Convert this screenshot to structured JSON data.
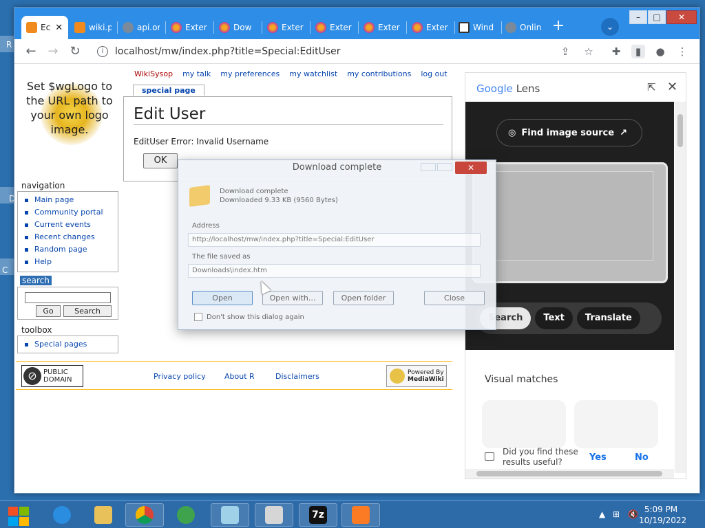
{
  "desktop": {
    "side_letters": [
      "R",
      "D",
      "C"
    ]
  },
  "browser": {
    "tabs": [
      {
        "label": "Ec",
        "icon": "mediawiki-favicon",
        "active": true
      },
      {
        "label": "wiki.p",
        "icon": "mediawiki-favicon"
      },
      {
        "label": "api.or",
        "icon": "globe-favicon"
      },
      {
        "label": "Exter",
        "icon": "firefox-favicon"
      },
      {
        "label": "Dow",
        "icon": "firefox-favicon"
      },
      {
        "label": "Exter",
        "icon": "firefox-favicon"
      },
      {
        "label": "Exter",
        "icon": "firefox-favicon"
      },
      {
        "label": "Exter",
        "icon": "firefox-favicon"
      },
      {
        "label": "Exter",
        "icon": "firefox-favicon"
      },
      {
        "label": "Wind",
        "icon": "library-favicon"
      },
      {
        "label": "Onlin",
        "icon": "globe-favicon"
      }
    ],
    "window_controls": {
      "minimize": "–",
      "maximize": "□",
      "close": "✕"
    },
    "url": "localhost/mw/index.php?title=Special:EditUser"
  },
  "wiki": {
    "logo_text": "Set $wgLogo to the URL path to your own logo image.",
    "personal": {
      "user": "WikiSysop",
      "links": [
        "my talk",
        "my preferences",
        "my watchlist",
        "my contributions",
        "log out"
      ]
    },
    "tab": "special page",
    "heading": "Edit User",
    "error": "EditUser Error: Invalid Username",
    "ok_label": "OK",
    "navigation": {
      "title": "navigation",
      "items": [
        "Main page",
        "Community portal",
        "Current events",
        "Recent changes",
        "Random page",
        "Help"
      ]
    },
    "search": {
      "title": "search",
      "go": "Go",
      "search": "Search"
    },
    "toolbox": {
      "title": "toolbox",
      "items": [
        "Special pages"
      ]
    },
    "footer": {
      "pd_line1": "PUBLIC",
      "pd_line2": "DOMAIN",
      "links": [
        "Privacy policy",
        "About R",
        "Disclaimers"
      ],
      "mw_line1": "Powered By",
      "mw_line2": "MediaWiki"
    }
  },
  "dialog": {
    "title": "Download complete",
    "close": "✕",
    "heading": "Download complete",
    "sub": "Downloaded 9.33 KB (9560 Bytes)",
    "address_label": "Address",
    "address": "http://localhost/mw/index.php?title=Special:EditUser",
    "saved_label": "The file saved as",
    "saved": "Downloads\\index.htm",
    "buttons": {
      "open": "Open",
      "open_with": "Open with...",
      "open_folder": "Open folder",
      "close": "Close"
    },
    "checkbox": "Don't show this dialog again"
  },
  "lens": {
    "google": "Google",
    "lens": "Lens",
    "find_source": "Find image source",
    "chips": [
      "Search",
      "Text",
      "Translate"
    ],
    "visual_matches": "Visual matches",
    "feedback_q": "Did you find these results useful?",
    "yes": "Yes",
    "no": "No"
  },
  "taskbar": {
    "time": "5:09 PM",
    "date": "10/19/2022"
  }
}
